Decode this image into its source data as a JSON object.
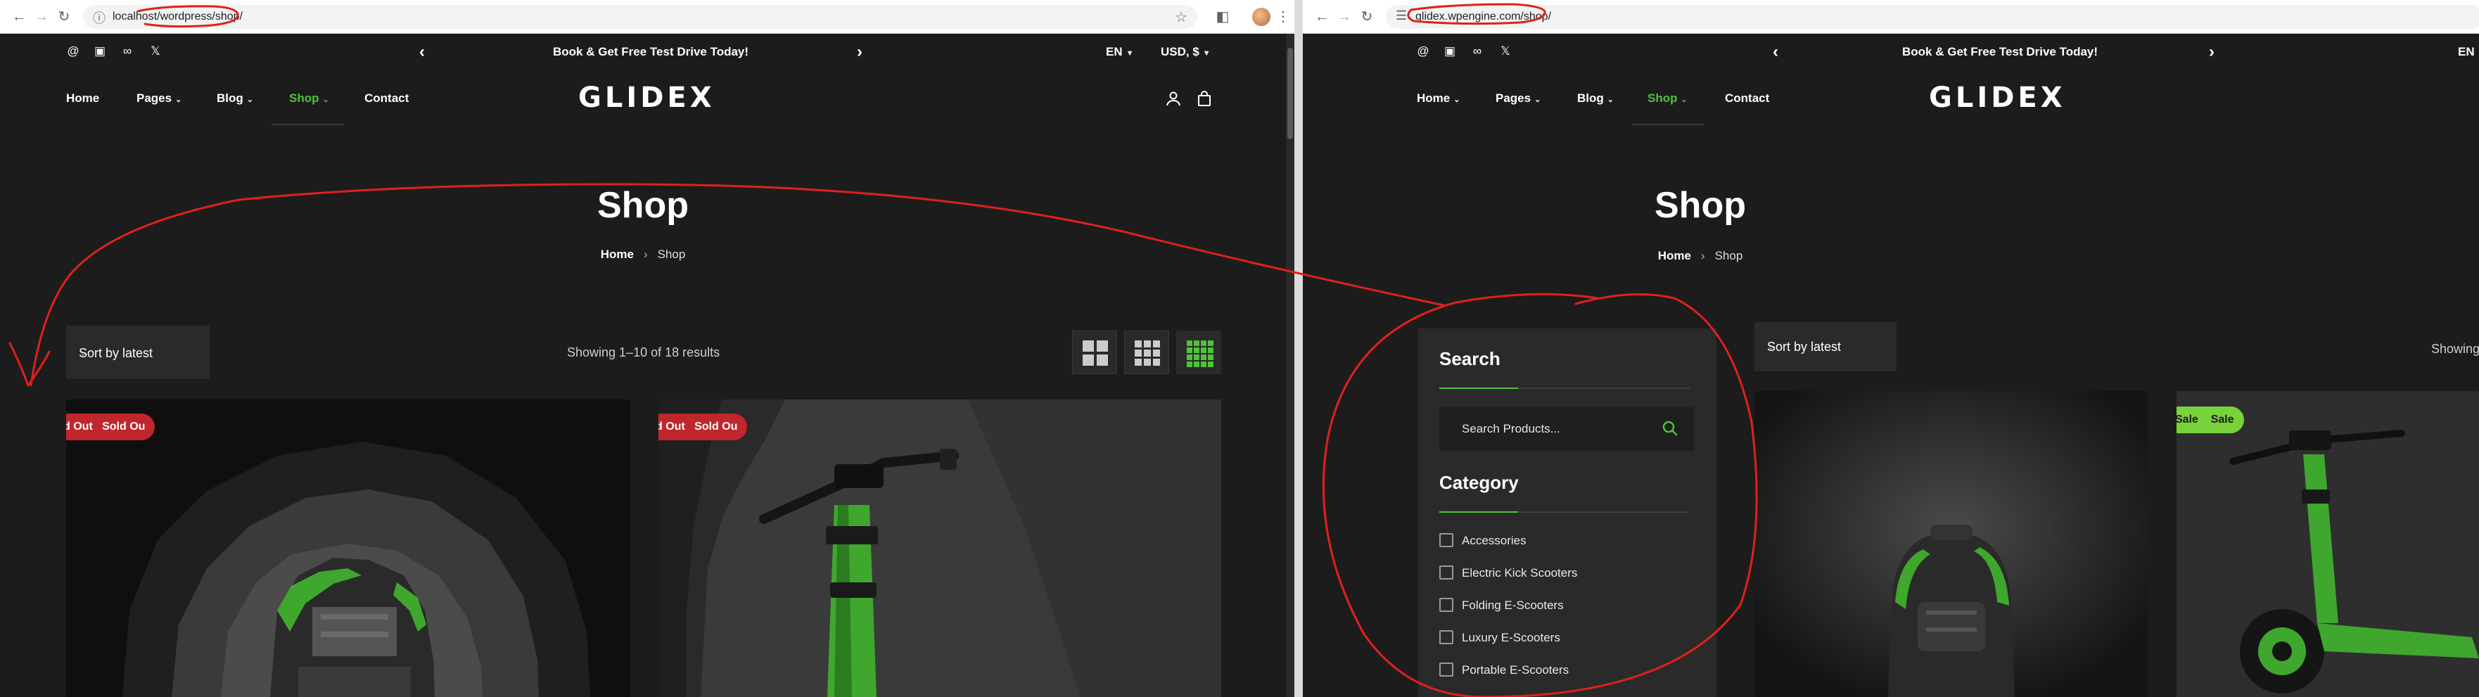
{
  "left_window": {
    "url": "localhost/wordpress/shop/",
    "topbar": {
      "promo": "Book & Get Free Test Drive Today!",
      "lang": "EN",
      "currency": "USD, $"
    },
    "nav": {
      "home": "Home",
      "pages": "Pages",
      "blog": "Blog",
      "shop": "Shop",
      "contact": "Contact"
    },
    "logo": "GLIDEX",
    "title": "Shop",
    "breadcrumb": {
      "home": "Home",
      "current": "Shop"
    },
    "sort_label": "Sort by latest",
    "results": "Showing 1–10 of 18 results",
    "badges": [
      "d Out",
      "Sold Ou",
      "d Out",
      "Sold Ou"
    ]
  },
  "right_window": {
    "url": "glidex.wpengine.com/shop/",
    "topbar": {
      "promo": "Book & Get Free Test Drive Today!",
      "lang": "EN"
    },
    "nav": {
      "home": "Home",
      "pages": "Pages",
      "blog": "Blog",
      "shop": "Shop",
      "contact": "Contact"
    },
    "logo": "GLIDEX",
    "title": "Shop",
    "breadcrumb": {
      "home": "Home",
      "current": "Shop"
    },
    "sort_label": "Sort by latest",
    "results": "Showing",
    "sidebar": {
      "search_heading": "Search",
      "search_placeholder": "Search Products...",
      "category_heading": "Category",
      "categories": [
        "Accessories",
        "Electric Kick Scooters",
        "Folding E-Scooters",
        "Luxury E-Scooters",
        "Portable E-Scooters"
      ]
    },
    "badges": [
      "Sale",
      "Sale"
    ]
  },
  "colors": {
    "accent": "#4fc23a",
    "sold_badge": "#c0262c",
    "sale_badge": "#7ad23b",
    "annotation": "#e0201c",
    "page_bg": "#1c1c1c"
  },
  "icons": [
    "back-arrow-icon",
    "forward-arrow-icon",
    "reload-icon",
    "site-info-icon",
    "bookmark-star-icon",
    "extensions-icon",
    "threads-icon",
    "instagram-icon",
    "meta-icon",
    "x-icon",
    "user-icon",
    "cart-icon",
    "grid-2-icon",
    "grid-3-icon",
    "grid-4-icon",
    "search-icon"
  ]
}
